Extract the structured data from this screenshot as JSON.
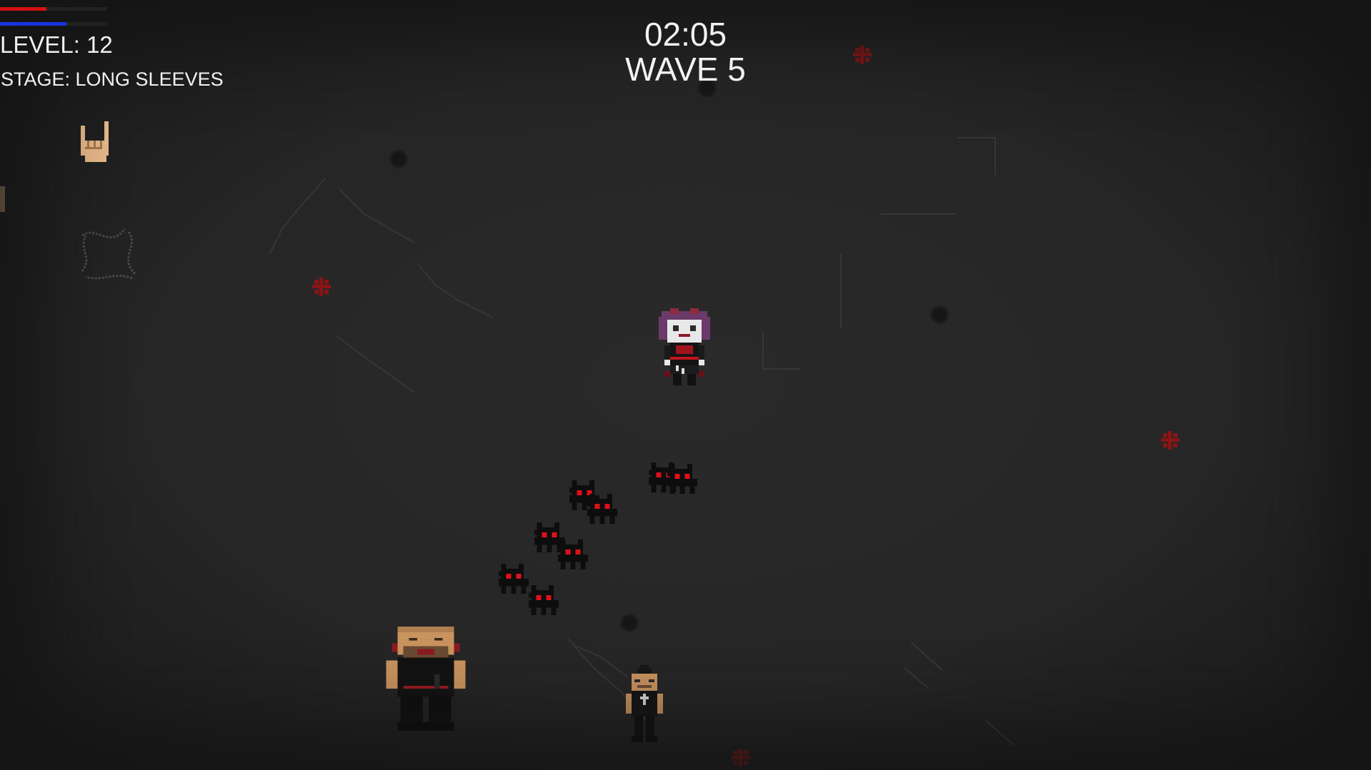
{
  "hud": {
    "health_fraction": 0.43,
    "mana_fraction": 0.62,
    "level_text": "LEVEL: 12",
    "stage_text": "STAGE: LONG SLEEVES",
    "timer": "02:05",
    "wave": "WAVE 5"
  },
  "weapons": [
    "rock-hand-icon",
    "spin-slash-icon"
  ],
  "colors": {
    "health": "#d11212",
    "mana": "#1a33e0",
    "enemy_eye": "#e0101a",
    "blood": "#8a1416"
  },
  "entities": {
    "player": "goth-girl-player",
    "cat_count": 10,
    "brutes": [
      "bald-bearded-brute",
      "mohawk-punk"
    ]
  }
}
